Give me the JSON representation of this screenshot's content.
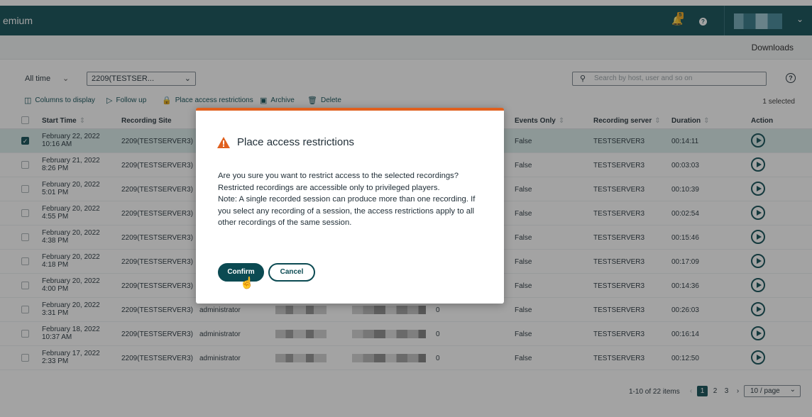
{
  "header": {
    "title": "emium",
    "notification_count": "5",
    "help_label": "?"
  },
  "subbar": {
    "downloads_label": "Downloads"
  },
  "filters": {
    "time_range": "All time",
    "site_value": "2209(TESTSER...",
    "search_placeholder": "Search by host, user and so on"
  },
  "toolbar": {
    "columns_label": "Columns to display",
    "follow_up_label": "Follow up",
    "restrict_label": "Place access restrictions",
    "archive_label": "Archive",
    "delete_label": "Delete",
    "selected_count": "1 selected"
  },
  "table": {
    "headers": {
      "start_time": "Start Time",
      "recording_site": "Recording Site",
      "events_only": "Events Only",
      "recording_server": "Recording server",
      "duration": "Duration",
      "action": "Action"
    },
    "rows": [
      {
        "date": "February 22, 2022",
        "time": "10:16 AM",
        "site": "2209(TESTSERVER3)",
        "user": "",
        "count": "",
        "events_only": "False",
        "server": "TESTSERVER3",
        "duration": "00:14:11",
        "selected": true
      },
      {
        "date": "February 21, 2022",
        "time": "8:26 PM",
        "site": "2209(TESTSERVER3)",
        "user": "",
        "count": "",
        "events_only": "False",
        "server": "TESTSERVER3",
        "duration": "00:03:03",
        "selected": false
      },
      {
        "date": "February 20, 2022",
        "time": "5:01 PM",
        "site": "2209(TESTSERVER3)",
        "user": "",
        "count": "",
        "events_only": "False",
        "server": "TESTSERVER3",
        "duration": "00:10:39",
        "selected": false
      },
      {
        "date": "February 20, 2022",
        "time": "4:55 PM",
        "site": "2209(TESTSERVER3)",
        "user": "",
        "count": "",
        "events_only": "False",
        "server": "TESTSERVER3",
        "duration": "00:02:54",
        "selected": false
      },
      {
        "date": "February 20, 2022",
        "time": "4:38 PM",
        "site": "2209(TESTSERVER3)",
        "user": "",
        "count": "",
        "events_only": "False",
        "server": "TESTSERVER3",
        "duration": "00:15:46",
        "selected": false
      },
      {
        "date": "February 20, 2022",
        "time": "4:18 PM",
        "site": "2209(TESTSERVER3)",
        "user": "",
        "count": "",
        "events_only": "False",
        "server": "TESTSERVER3",
        "duration": "00:17:09",
        "selected": false
      },
      {
        "date": "February 20, 2022",
        "time": "4:00 PM",
        "site": "2209(TESTSERVER3)",
        "user": "",
        "count": "",
        "events_only": "False",
        "server": "TESTSERVER3",
        "duration": "00:14:36",
        "selected": false
      },
      {
        "date": "February 20, 2022",
        "time": "3:31 PM",
        "site": "2209(TESTSERVER3)",
        "user": "administrator",
        "count": "0",
        "events_only": "False",
        "server": "TESTSERVER3",
        "duration": "00:26:03",
        "selected": false
      },
      {
        "date": "February 18, 2022",
        "time": "10:37 AM",
        "site": "2209(TESTSERVER3)",
        "user": "administrator",
        "count": "0",
        "events_only": "False",
        "server": "TESTSERVER3",
        "duration": "00:16:14",
        "selected": false
      },
      {
        "date": "February 17, 2022",
        "time": "2:33 PM",
        "site": "2209(TESTSERVER3)",
        "user": "administrator",
        "count": "0",
        "events_only": "False",
        "server": "TESTSERVER3",
        "duration": "00:12:50",
        "selected": false
      }
    ]
  },
  "pagination": {
    "range": "1-10 of 22 items",
    "pages": [
      "1",
      "2",
      "3"
    ],
    "current": "1",
    "per_page": "10 / page"
  },
  "modal": {
    "title": "Place access restrictions",
    "body_lines": [
      "Are you sure you want to restrict access to the selected recordings?",
      "Restricted recordings are accessible only to privileged players.",
      "Note: A single recorded session can produce more than one recording. If",
      "you select any recording of a session, the access restrictions apply to all",
      "other recordings of the same session."
    ],
    "confirm_label": "Confirm",
    "cancel_label": "Cancel"
  },
  "colors": {
    "brand": "#0b4a52",
    "warning": "#e0601e",
    "selected_row": "#d9ecea"
  }
}
